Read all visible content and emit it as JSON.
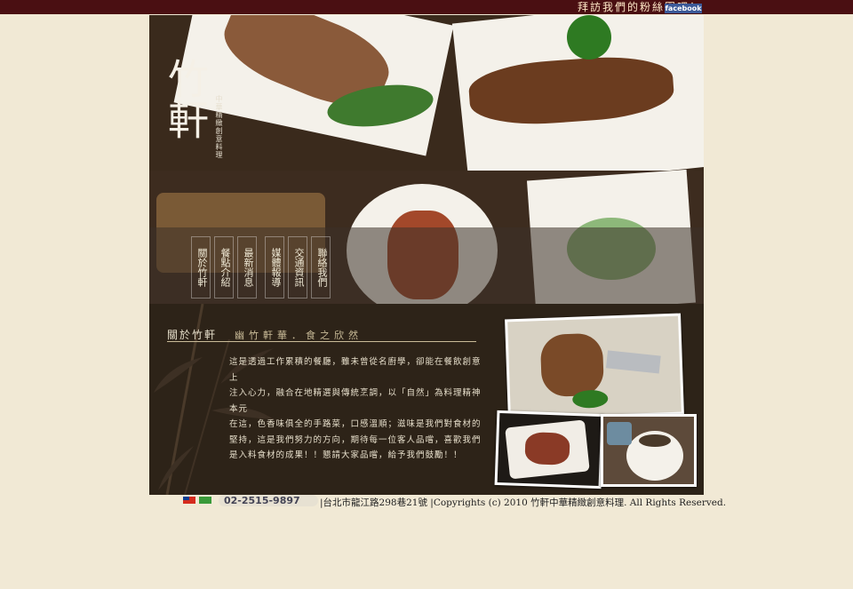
{
  "topbar": {
    "fan_link": "拜訪我們的粉絲團吧！",
    "facebook_badge": "facebook"
  },
  "logo": {
    "name": "竹軒",
    "tagline": "中華精緻創意料理"
  },
  "nav": {
    "items": [
      "關於竹軒",
      "餐點介紹",
      "最新消息",
      "媒體報導",
      "交通資訊",
      "聯絡我們"
    ]
  },
  "about": {
    "heading": "關於竹軒",
    "subheading": "幽竹軒華．食之欣然",
    "lines": [
      "這是透過工作累積的餐廳，雖未曾從名廚學，卻能在餐飲創意上",
      "注入心力，融合在地精選與傳統烹調，以「自然」為料理精神本元",
      "在這，色香味俱全的手路菜，口感溫順；滋味是我們對食材的",
      "堅持，這是我們努力的方向，期待每一位客人品嚐，喜歡我們",
      "是入料食材的成果！！懇請大家品嚐，給予我們鼓勵！！"
    ]
  },
  "footer": {
    "phone": "02-2515-9897",
    "address_copyright": "|台北市龍江路298巷21號 |Copyrights (c) 2010 竹軒中華精緻創意料理. All Rights Reserved."
  },
  "colors": {
    "topbar": "#4a0f12",
    "page_bg": "#f1e9d5",
    "panel": "#2d2318"
  }
}
